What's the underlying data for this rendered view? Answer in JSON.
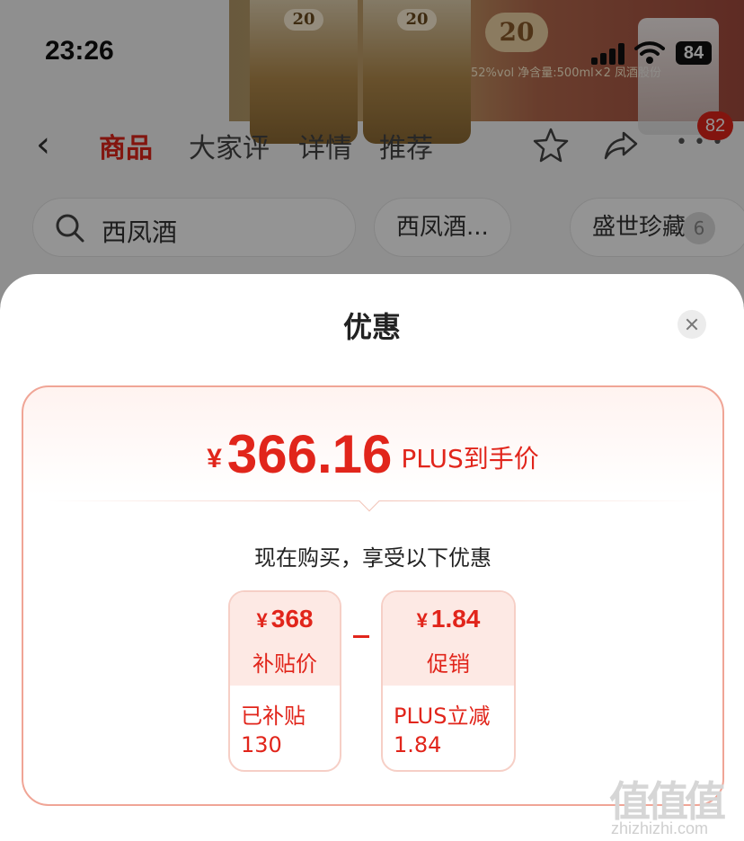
{
  "status_bar": {
    "time": "23:26",
    "battery": "84"
  },
  "hero": {
    "bottle_number": "20",
    "badge_number": "20",
    "caption": "52%vol 净含量:500ml×2 凤酒股份"
  },
  "nav": {
    "tabs": [
      {
        "label": "商品",
        "active": true
      },
      {
        "label": "大家评",
        "active": false
      },
      {
        "label": "详情",
        "active": false
      },
      {
        "label": "推荐",
        "active": false
      }
    ],
    "message_count": "82"
  },
  "search": {
    "query": "西凤酒",
    "chips": [
      "西凤酒...",
      "盛世珍藏"
    ],
    "chip_count": "6"
  },
  "sheet": {
    "title": "优惠",
    "final_price": {
      "currency": "¥",
      "value": "366.16",
      "label": "PLUS到手价"
    },
    "subtitle": "现在购买，享受以下优惠",
    "breakdown": [
      {
        "currency": "¥",
        "value": "368",
        "label": "补贴价",
        "desc_line1": "已补贴",
        "desc_line2": "130"
      },
      {
        "currency": "¥",
        "value": "1.84",
        "label": "促销",
        "desc_line1": "PLUS立减",
        "desc_line2": "1.84"
      }
    ]
  },
  "watermark": {
    "logo": "值值值",
    "url": "zhizhizhi.com"
  },
  "colors": {
    "accent": "#e1251b",
    "card_border": "#f0a596",
    "card_tint": "#fde9e4"
  }
}
